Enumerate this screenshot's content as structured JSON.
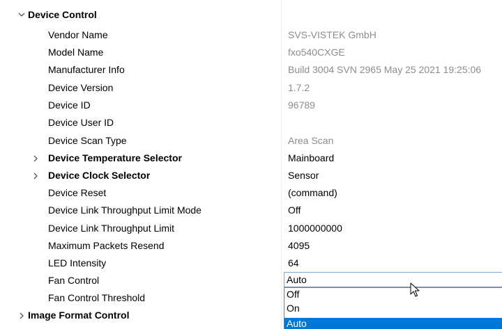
{
  "tree": {
    "group_label": "Device Control",
    "rows": [
      {
        "name": "Vendor Name",
        "value": "SVS-VISTEK GmbH",
        "readonly": true
      },
      {
        "name": "Model Name",
        "value": "fxo540CXGE",
        "readonly": true
      },
      {
        "name": "Manufacturer Info",
        "value": "Build 3004 SVN 2965 May 25 2021 19:25:06",
        "readonly": true
      },
      {
        "name": "Device Version",
        "value": "1.7.2",
        "readonly": true
      },
      {
        "name": "Device ID",
        "value": "96789",
        "readonly": true
      },
      {
        "name": "Device User ID",
        "value": "",
        "readonly": false
      },
      {
        "name": "Device Scan Type",
        "value": "Area Scan",
        "readonly": true
      },
      {
        "name": "Device Temperature Selector",
        "value": "Mainboard",
        "readonly": false
      },
      {
        "name": "Device Clock Selector",
        "value": "Sensor",
        "readonly": false
      },
      {
        "name": "Device Reset",
        "value": "(command)",
        "readonly": false
      },
      {
        "name": "Device Link Throughput Limit Mode",
        "value": "Off",
        "readonly": false
      },
      {
        "name": "Device Link Throughput Limit",
        "value": "1000000000",
        "readonly": false
      },
      {
        "name": "Maximum Packets Resend",
        "value": "4095",
        "readonly": false
      },
      {
        "name": "LED Intensity",
        "value": "64",
        "readonly": false
      },
      {
        "name": "Fan Control",
        "value": "",
        "readonly": false
      },
      {
        "name": "Fan Control Threshold",
        "value": "",
        "readonly": false
      }
    ],
    "next_group_label": "Image Format Control"
  },
  "fan_control_dropdown": {
    "selected": "Auto",
    "options": [
      "Off",
      "On",
      "Auto"
    ],
    "highlighted": "Auto"
  }
}
